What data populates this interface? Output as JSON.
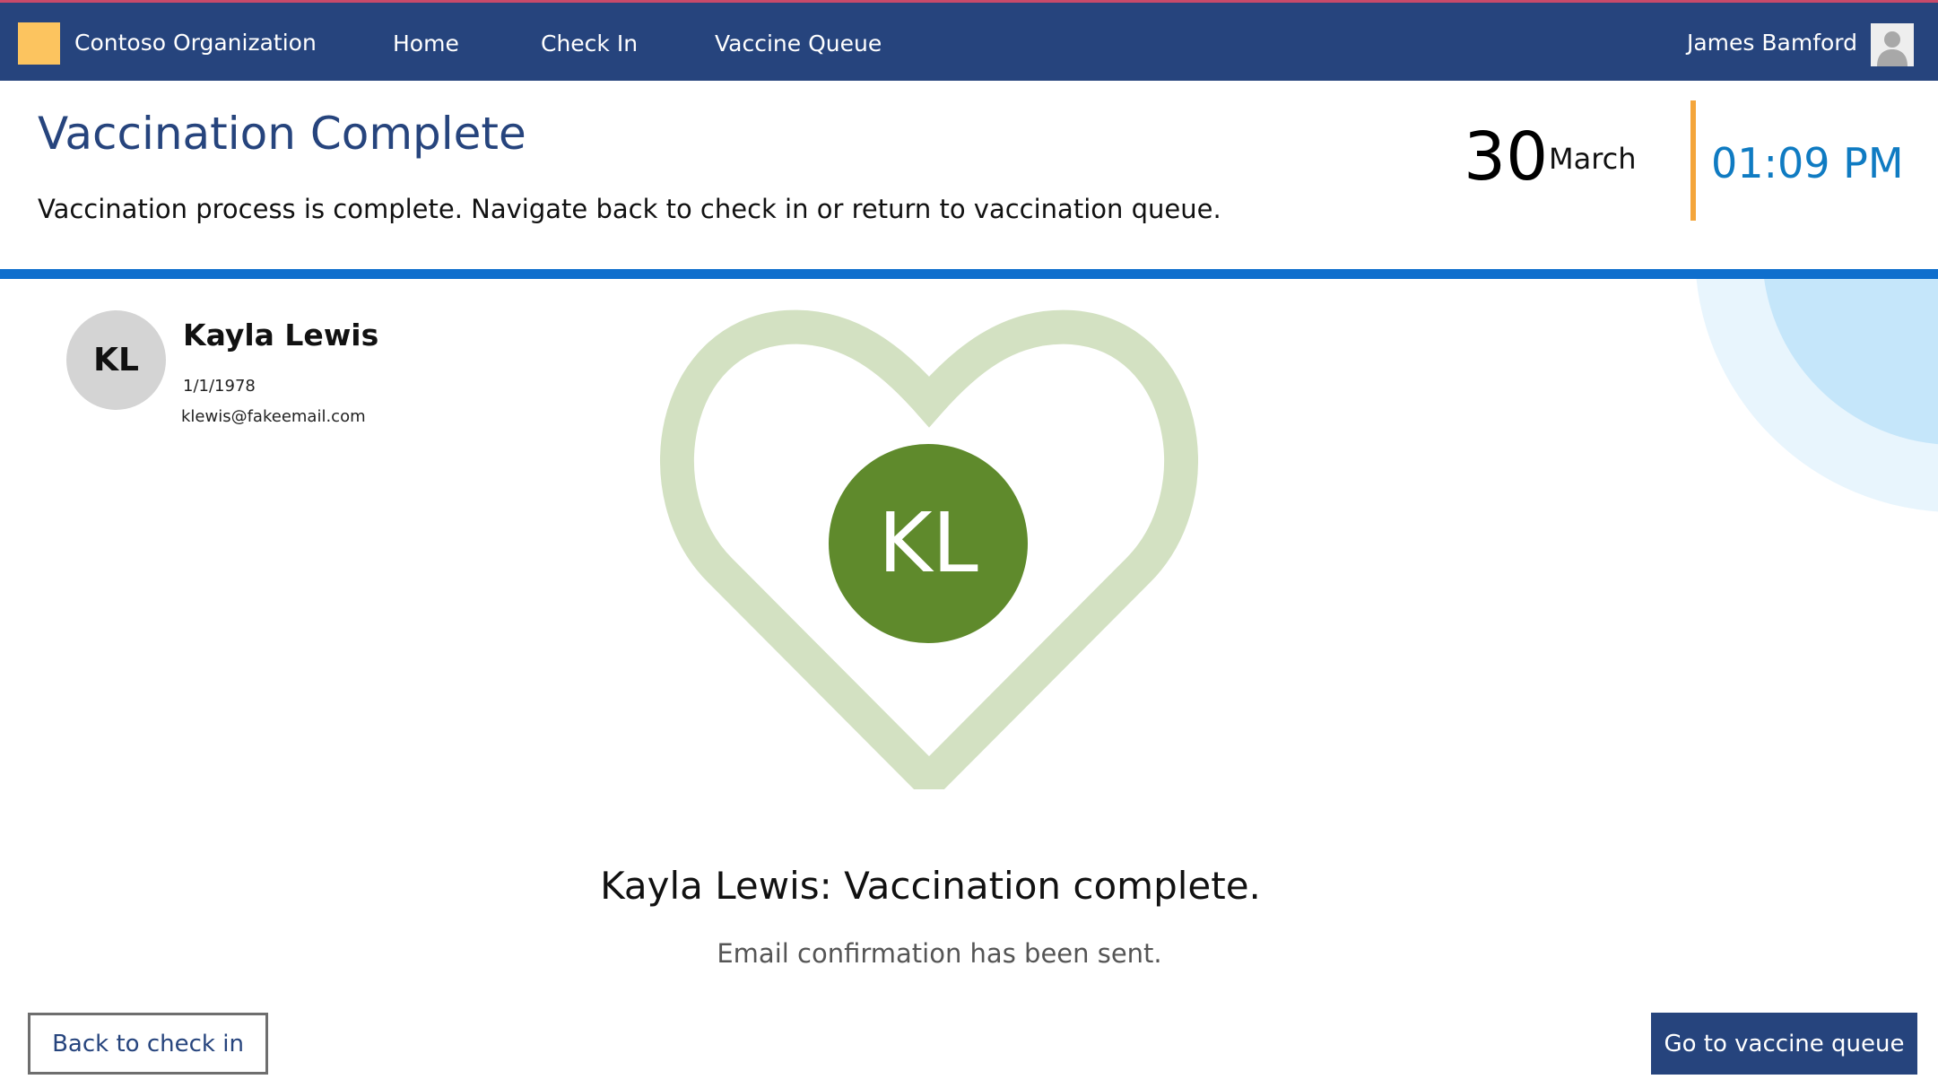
{
  "nav": {
    "org_name": "Contoso Organization",
    "links": [
      "Home",
      "Check In",
      "Vaccine Queue"
    ],
    "user_name": "James Bamford"
  },
  "header": {
    "title": "Vaccination Complete",
    "subtitle": "Vaccination process is complete. Navigate back to check in or return to vaccination queue.",
    "date_day": "30",
    "date_month": "March",
    "time": "01:09 PM"
  },
  "patient": {
    "initials": "KL",
    "name": "Kayla Lewis",
    "dob": "1/1/1978",
    "email": "klewis@fakeemail.com"
  },
  "confirmation": {
    "heading": "Kayla Lewis: Vaccination complete.",
    "subtext": "Email confirmation has been sent."
  },
  "buttons": {
    "back": "Back to check in",
    "queue": "Go to vaccine queue"
  },
  "colors": {
    "nav_bg": "#26447d",
    "logo_accent": "#fcc45f",
    "title": "#26447d",
    "time": "#0f7bc2",
    "date_divider": "#f4a53b",
    "header_rule": "#0f6fcd",
    "heart": "#d3e1c2",
    "avatar_green": "#5f8a2c"
  },
  "icons": {
    "user_avatar": "person-silhouette-icon",
    "heart": "heart-outline-icon"
  }
}
